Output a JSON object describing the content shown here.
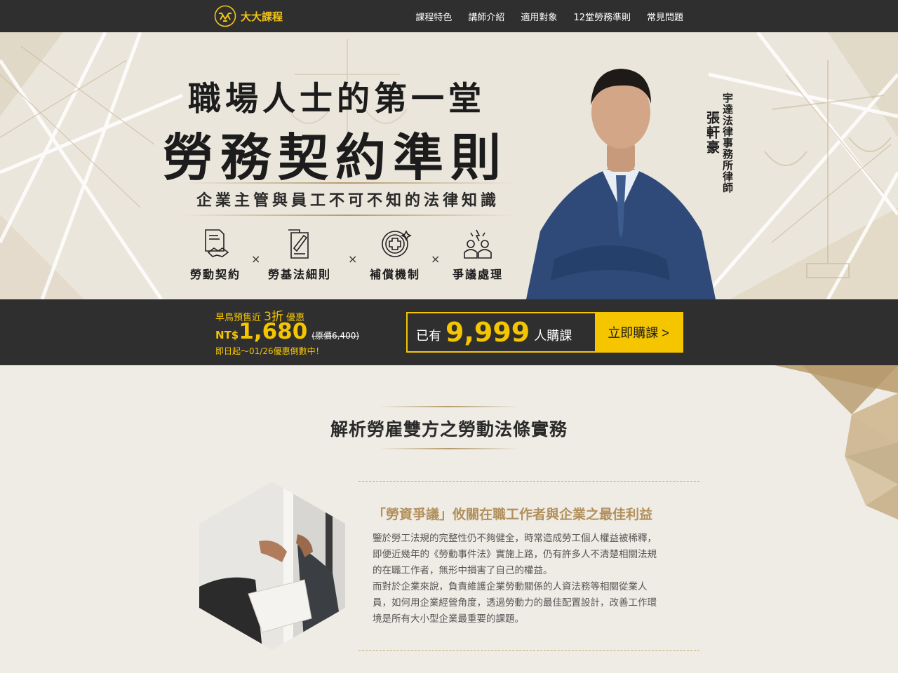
{
  "brand": {
    "name": "大大課程",
    "accent": "#f5c500",
    "gold": "#b2905c"
  },
  "nav": {
    "items": [
      "課程特色",
      "講師介紹",
      "適用對象",
      "12堂勞務準則",
      "常見問題"
    ]
  },
  "hero": {
    "title_line1": "職場人士的第一堂",
    "title_line2": "勞務契約準則",
    "subtitle": "企業主管與員工不可不知的法律知識",
    "features": [
      {
        "icon": "contract-handshake-icon",
        "label": "勞動契約"
      },
      {
        "icon": "rules-document-icon",
        "label": "勞基法細則"
      },
      {
        "icon": "medical-cross-icon",
        "label": "補償機制"
      },
      {
        "icon": "dispute-people-icon",
        "label": "爭議處理"
      }
    ],
    "times_sign": "×",
    "lawyer_name": "張軒豪",
    "lawyer_title": "宇達法律事務所律師"
  },
  "pricing": {
    "promo_prefix": "早鳥預售近",
    "promo_discount": "3折",
    "promo_suffix": "優惠",
    "currency": "NT$",
    "price": "1,680",
    "original_price": "(原價6,400)",
    "deadline": "即日起～01/26優惠倒數中！",
    "buyers_prefix": "已有",
    "buyers_count": "9,999",
    "buyers_suffix": "人購課",
    "buy_button": "立即購課 >"
  },
  "section": {
    "title": "解析勞雇雙方之勞動法條實務",
    "article_title": "「勞資爭議」攸關在職工作者與企業之最佳利益",
    "article_lines": [
      "鑒於勞工法規的完整性仍不夠健全，時常造成勞工個人權益被稀釋，",
      "即便近幾年的《勞動事件法》實施上路，仍有許多人不清楚相關法規",
      "的在職工作者，無形中損害了自己的權益。",
      "而對於企業來說，負責維護企業勞動關係的人資法務等相關從業人",
      "員，如何用企業經營角度，透過勞動力的最佳配置設計，改善工作環",
      "境是所有大小型企業最重要的課題。"
    ]
  }
}
